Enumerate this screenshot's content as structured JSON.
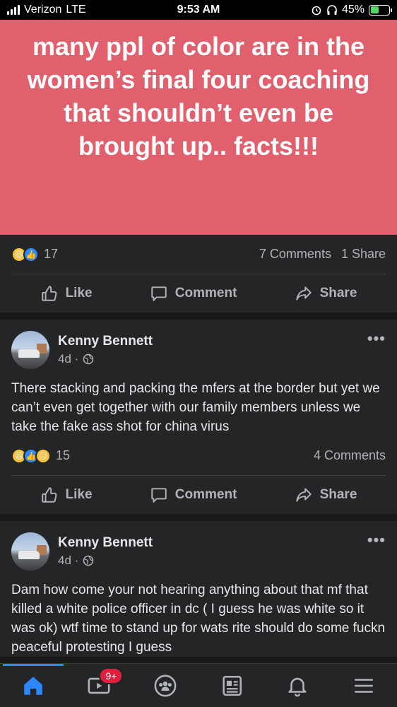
{
  "status_bar": {
    "carrier": "Verizon",
    "network": "LTE",
    "time": "9:53 AM",
    "battery": "45%"
  },
  "post1": {
    "banner_text": "many ppl of color are in the women’s final four coaching that shouldn’t even be brought up.. facts!!!",
    "reaction_count": "17",
    "comments": "7 Comments",
    "shares": "1 Share",
    "actions": {
      "like": "Like",
      "comment": "Comment",
      "share": "Share"
    }
  },
  "post2": {
    "author": "Kenny Bennett",
    "time": "4d ·",
    "body": "There stacking and packing the mfers at the border but yet we can’t even get together with our family members unless we take the fake ass shot for china virus",
    "reaction_count": "15",
    "comments": "4 Comments",
    "actions": {
      "like": "Like",
      "comment": "Comment",
      "share": "Share"
    }
  },
  "post3": {
    "author": "Kenny Bennett",
    "time": "4d ·",
    "body": "Dam how come your not hearing anything about that mf that killed a white police officer in dc ( I guess he was white so it was ok) wtf time to stand up for wats rite should do some fuckn peaceful protesting I guess"
  },
  "tab_bar": {
    "video_badge": "9+"
  },
  "colors": {
    "accent": "#2d88ff",
    "banner": "#e0606e",
    "badge": "#e41e3f"
  }
}
